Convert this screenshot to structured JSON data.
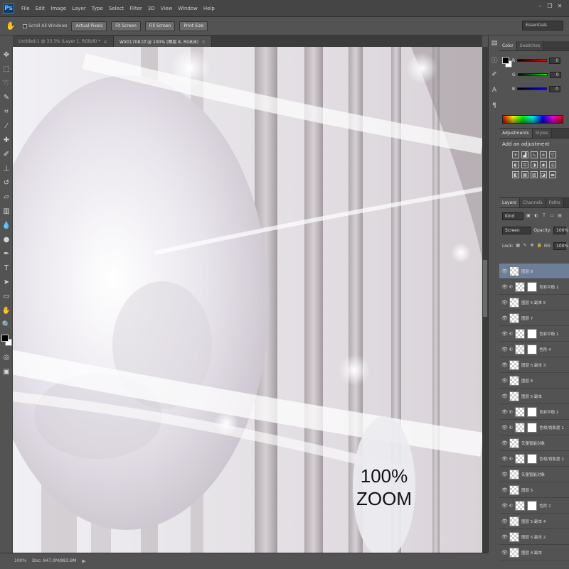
{
  "app": {
    "logo": "Ps",
    "menus": [
      "File",
      "Edit",
      "Image",
      "Layer",
      "Type",
      "Select",
      "Filter",
      "3D",
      "View",
      "Window",
      "Help"
    ]
  },
  "options": {
    "scroll_all_windows": "Scroll All Windows",
    "actual_pixels": "Actual Pixels",
    "fit_screen": "Fit Screen",
    "fill_screen": "Fill Screen",
    "print_size": "Print Size",
    "workspace": "Essentials"
  },
  "doc_tabs": [
    {
      "label": "Untitled-1 @ 33.3% (Layer 1, RGB/8) *"
    },
    {
      "label": "WX01708.tif @ 100% (图层 8, RGB/8)"
    }
  ],
  "status": {
    "zoom": "100%",
    "doc": "Doc: 847.0M/883.8M"
  },
  "color_panel": {
    "tabs": [
      "Color",
      "Swatches"
    ],
    "r_label": "R",
    "r_value": "0",
    "g_label": "G",
    "g_value": "0",
    "b_label": "B",
    "b_value": "0"
  },
  "adjustments": {
    "tabs": [
      "Adjustments",
      "Styles"
    ],
    "title": "Add an adjustment"
  },
  "layers_panel": {
    "tabs": [
      "Layers",
      "Channels",
      "Paths"
    ],
    "filter": "Kind",
    "blend_mode": "Screen",
    "opacity_label": "Opacity:",
    "opacity_value": "100%",
    "lock_label": "Lock:",
    "fill_label": "Fill:",
    "fill_value": "100%"
  },
  "layers": [
    {
      "name": "图层 8",
      "selected": true,
      "mask": false
    },
    {
      "name": "色彩平衡 1",
      "mask": true
    },
    {
      "name": "图层 5 副本 5",
      "mask": false
    },
    {
      "name": "图层 7",
      "mask": false
    },
    {
      "name": "色彩平衡 1",
      "mask": true
    },
    {
      "name": "色阶 4",
      "mask": true
    },
    {
      "name": "图层 5 副本 3",
      "mask": false
    },
    {
      "name": "图层 6",
      "mask": false
    },
    {
      "name": "图层 5 副本",
      "mask": false
    },
    {
      "name": "色彩平衡 2",
      "mask": true
    },
    {
      "name": "色相/饱和度 1",
      "mask": true
    },
    {
      "name": "矢量智能对象",
      "mask": false
    },
    {
      "name": "色相/饱和度 2",
      "mask": true
    },
    {
      "name": "矢量智能对象",
      "mask": false
    },
    {
      "name": "图层 5",
      "mask": false
    },
    {
      "name": "色阶 2",
      "mask": true
    },
    {
      "name": "图层 5 副本 4",
      "mask": false
    },
    {
      "name": "图层 5 副本 2",
      "mask": false
    },
    {
      "name": "图层 4 副本",
      "mask": false
    }
  ],
  "canvas": {
    "zoom_line1": "100%",
    "zoom_line2": "ZOOM"
  }
}
